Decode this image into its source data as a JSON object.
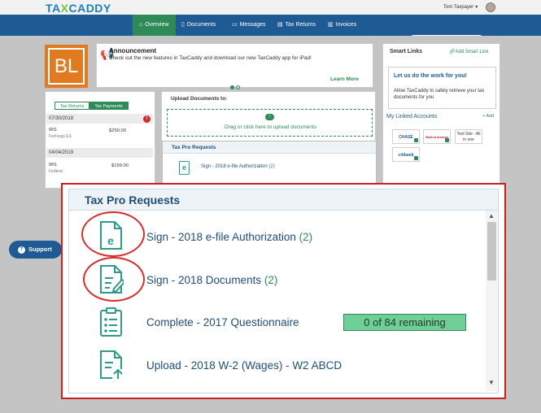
{
  "header": {
    "logo_main": "TA",
    "logo_x": "X",
    "logo_rest": "CADDY",
    "user_name": "Tom Taxpayer"
  },
  "nav": {
    "items": [
      {
        "label": "Overview",
        "icon": "home-icon"
      },
      {
        "label": "Documents",
        "icon": "document-icon"
      },
      {
        "label": "Messages",
        "icon": "message-icon"
      },
      {
        "label": "Tax Returns",
        "icon": "tax-returns-icon"
      },
      {
        "label": "Invoices",
        "icon": "invoice-icon"
      }
    ],
    "active": "Overview"
  },
  "profile": {
    "initials": "BL"
  },
  "announcement": {
    "title": "Announcement",
    "text": "Check out the new features in TaxCaddy and download our new TaxCaddy app for iPad!",
    "learn_more": "Learn More"
  },
  "payments": {
    "tabs": [
      "Tax Returns",
      "Tax Payments"
    ],
    "active_tab": "Tax Payments",
    "groups": [
      {
        "date": "07/30/2018",
        "alert": "!",
        "payee": "IRS",
        "detail": "Fed-tugs ES",
        "amount": "$250.00"
      },
      {
        "date": "04/04/2019",
        "payee": "IRS",
        "detail": "Federal",
        "amount": "$159.00"
      }
    ]
  },
  "upload": {
    "title": "Upload Documents to:",
    "drop_text": "Drag or click here to upload documents"
  },
  "smart_links": {
    "title": "Smart Links",
    "add_label": "Add Smart Link",
    "promo_title": "Let us do the work for you!",
    "promo_text": "Allow TaxCaddy to safely retrieve your tax documents for you",
    "linked_title": "My Linked Accounts",
    "linked_add": "+ Add",
    "banks": [
      "CHASE",
      "Bank of America",
      "Test Site - All in one",
      "citibank"
    ]
  },
  "mini_requests": {
    "title": "Tax Pro Requests",
    "item_label": "Sign - 2018 e-file Authorization",
    "item_count": "(2)"
  },
  "support": {
    "label": "Support"
  },
  "tax_pro_requests": {
    "title": "Tax Pro Requests",
    "items": [
      {
        "label": "Sign - 2018 e-file Authorization",
        "count": "(2)",
        "icon": "efile-document-icon"
      },
      {
        "label": "Sign - 2018 Documents",
        "count": "(2)",
        "icon": "sign-document-icon"
      },
      {
        "label": "Complete - 2017 Questionnaire",
        "count": "",
        "icon": "questionnaire-clipboard-icon",
        "badge": "0 of 84 remaining"
      },
      {
        "label": "Upload - 2018 W-2 (Wages) - W2 ABCD",
        "count": "",
        "icon": "upload-document-icon"
      }
    ]
  },
  "colors": {
    "nav_blue": "#1e5b94",
    "accent_green": "#2e8b57",
    "highlight_red": "#cc1f1f",
    "badge_green": "#6fcf97"
  }
}
